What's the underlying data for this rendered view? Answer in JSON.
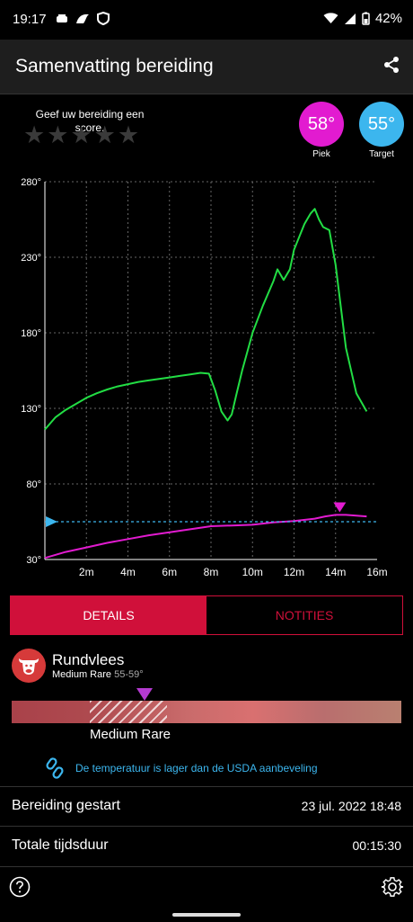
{
  "status": {
    "time": "19:17",
    "battery": "42%",
    "icons": [
      "notification-icon",
      "app-icon",
      "shield-icon",
      "wifi-icon",
      "signal-icon",
      "battery-icon"
    ]
  },
  "header": {
    "title": "Samenvatting bereiding",
    "share_icon": "share-icon"
  },
  "rating": {
    "prompt": "Geef uw bereiding een score.",
    "stars": 5,
    "value": 0
  },
  "temps": {
    "peak_value": "58°",
    "peak_label": "Piek",
    "peak_color": "#e21bd0",
    "target_value": "55°",
    "target_label": "Target",
    "target_color": "#3cb6ee"
  },
  "chart_data": {
    "type": "line",
    "y_ticks": [
      "280°",
      "230°",
      "180°",
      "130°",
      "80°",
      "30°"
    ],
    "x_ticks": [
      "2m",
      "4m",
      "6m",
      "8m",
      "10m",
      "12m",
      "14m",
      "16m"
    ],
    "xlim": [
      0,
      16
    ],
    "ylim": [
      30,
      280
    ],
    "grid": true,
    "series": [
      {
        "color": "#22dd44",
        "x": [
          0,
          0.5,
          1,
          1.5,
          2,
          2.5,
          3,
          3.5,
          4,
          4.5,
          5,
          5.5,
          6,
          6.5,
          7,
          7.5,
          7.9,
          8.2,
          8.5,
          8.8,
          9.0,
          9.2,
          9.5,
          10,
          10.5,
          11,
          11.2,
          11.5,
          11.8,
          12,
          12.5,
          12.8,
          13,
          13.2,
          13.4,
          13.7,
          14,
          14.5,
          15,
          15.5
        ],
        "y": [
          116,
          124,
          129,
          133,
          137,
          140,
          142.5,
          144.5,
          146,
          147.5,
          148.5,
          149.5,
          150.5,
          151.5,
          152.5,
          153.5,
          153,
          142,
          128,
          122,
          126,
          138,
          155,
          180,
          198,
          214,
          222,
          215,
          222,
          235,
          252,
          259,
          262,
          255,
          250,
          248,
          225,
          170,
          140,
          128
        ]
      },
      {
        "color": "#e21bd0",
        "x": [
          0,
          1,
          2,
          3,
          4,
          5,
          6,
          7,
          8,
          9,
          10,
          11,
          12,
          13,
          13.5,
          14,
          14.5,
          15,
          15.5
        ],
        "y": [
          31,
          35,
          38,
          41,
          43.5,
          46,
          48,
          50,
          52,
          52.5,
          53,
          54.5,
          55.5,
          57,
          58.5,
          59.5,
          59.5,
          59,
          58.5
        ]
      },
      {
        "color": "#3cb6ee",
        "dashed": true,
        "x": [
          0,
          16
        ],
        "y": [
          55,
          55
        ]
      }
    ],
    "peak_marker": {
      "x": 14.2,
      "y": 59.5,
      "color": "#e21bd0"
    },
    "target_marker": {
      "y": 55,
      "color": "#3cb6ee"
    }
  },
  "tabs": [
    {
      "label": "DETAILS",
      "active": true
    },
    {
      "label": "NOTITIES",
      "active": false
    }
  ],
  "meat": {
    "icon": "cow-icon",
    "name": "Rundvlees",
    "doneness": "Medium Rare",
    "range": "55-59°",
    "bar_label": "Medium Rare",
    "marker_position": 0.34
  },
  "usda": {
    "icon": "link-icon",
    "text": "De temperatuur is lager dan de USDA aanbeveling"
  },
  "info_rows": [
    {
      "label": "Bereiding gestart",
      "value": "23 jul. 2022 18:48"
    },
    {
      "label": "Totale tijdsduur",
      "value": "00:15:30"
    }
  ],
  "footer": {
    "help_icon": "help-icon",
    "settings_icon": "gear-icon"
  }
}
